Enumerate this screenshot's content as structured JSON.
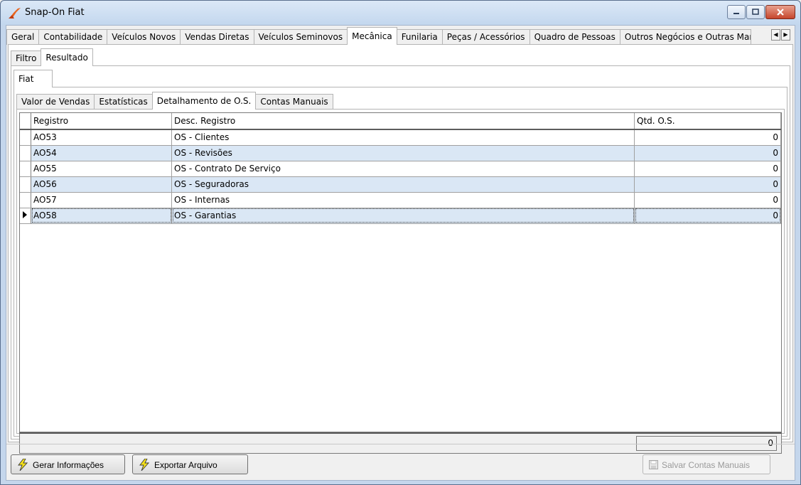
{
  "window": {
    "title": "Snap-On Fiat"
  },
  "main_tabs": [
    "Geral",
    "Contabilidade",
    "Veículos Novos",
    "Vendas Diretas",
    "Veículos Seminovos",
    "Mecânica",
    "Funilaria",
    "Peças / Acessórios",
    "Quadro de Pessoas",
    "Outros Negócios e Outras Mar"
  ],
  "main_tab_active": "Mecânica",
  "sub_tabs": [
    "Filtro",
    "Resultado"
  ],
  "brand_tabs": [
    "Fiat"
  ],
  "detail_tabs": [
    "Valor de Vendas",
    "Estatísticas",
    "Detalhamento de O.S.",
    "Contas Manuais"
  ],
  "grid": {
    "columns": [
      "Registro",
      "Desc. Registro",
      "Qtd. O.S."
    ],
    "rows": [
      {
        "registro": "AO53",
        "desc": "OS - Clientes",
        "qtd": "0"
      },
      {
        "registro": "AO54",
        "desc": "OS - Revisões",
        "qtd": "0"
      },
      {
        "registro": "AO55",
        "desc": "OS - Contrato De Serviço",
        "qtd": "0"
      },
      {
        "registro": "AO56",
        "desc": "OS - Seguradoras",
        "qtd": "0"
      },
      {
        "registro": "AO57",
        "desc": "OS - Internas",
        "qtd": "0"
      },
      {
        "registro": "AO58",
        "desc": "OS - Garantias",
        "qtd": "0"
      }
    ],
    "total": "0"
  },
  "buttons": {
    "gerar": "Gerar Informações",
    "exportar": "Exportar Arquivo",
    "salvar": "Salvar Contas Manuais"
  },
  "icons": {
    "app": "snapon-logo-icon",
    "gerar": "lightning-icon",
    "exportar": "lightning-icon",
    "salvar": "floppy-disk-icon"
  },
  "colors": {
    "row_alt": "#dae7f5",
    "title_bar": "#c4d6ec",
    "close_button": "#c6452c"
  }
}
